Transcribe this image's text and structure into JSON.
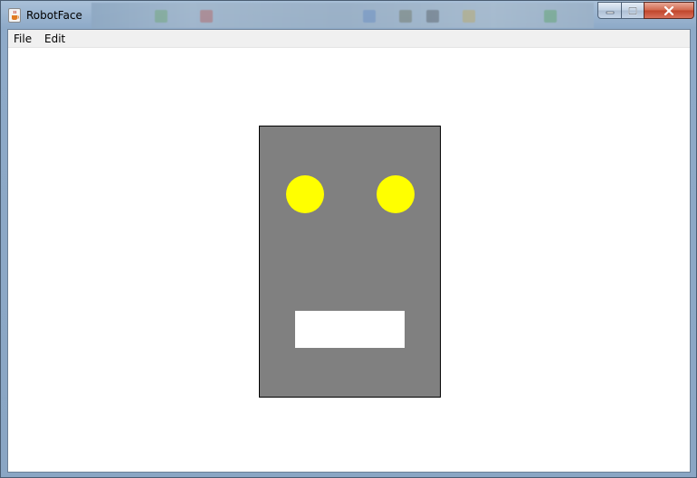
{
  "window": {
    "title": "RobotFace",
    "frame_color": "#8eaac8"
  },
  "menubar": {
    "items": [
      "File",
      "Edit"
    ]
  },
  "robot": {
    "head_color": "#808080",
    "eye_color": "#ffff00",
    "mouth_color": "#ffffff"
  },
  "icons": {
    "app": "java-cup-icon",
    "minimize": "minimize-icon",
    "maximize": "maximize-icon",
    "close": "close-icon"
  }
}
